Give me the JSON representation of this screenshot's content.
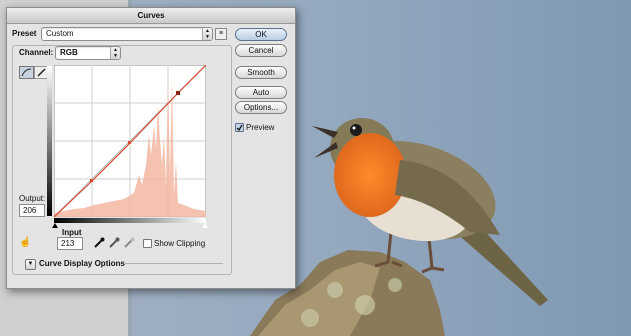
{
  "dialog": {
    "title": "Curves",
    "preset_label": "Preset",
    "preset_value": "Custom",
    "channel_label": "Channel:",
    "channel_value": "RGB",
    "output_label": "Output:",
    "output_value": "206",
    "input_label": "Input",
    "input_value": "213",
    "show_clipping_label": "Show Clipping",
    "curve_display_label": "Curve Display Options",
    "buttons": {
      "ok": "OK",
      "cancel": "Cancel",
      "smooth": "Smooth",
      "auto": "Auto",
      "options": "Options..."
    },
    "preview_label": "Preview",
    "preview_checked": true,
    "show_clipping_checked": false
  },
  "icons": {
    "preset_menu": "preset-options-icon",
    "curve_tool": "curve-point-tool-icon",
    "pencil_tool": "pencil-tool-icon",
    "hand_tool": "on-image-adjust-icon",
    "eyedroppers": [
      "black-eyedropper-icon",
      "gray-eyedropper-icon",
      "white-eyedropper-icon"
    ],
    "disclosure": "disclosure-triangle-icon"
  },
  "colors": {
    "accent_default_button": "#b9cde4",
    "histogram_fill": "#f2b7a1",
    "curve_line": "#d4492f"
  }
}
